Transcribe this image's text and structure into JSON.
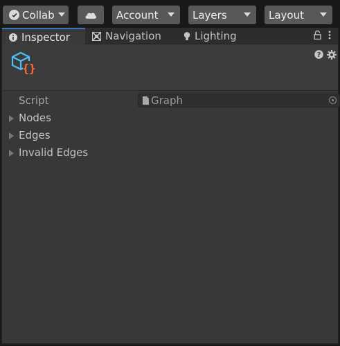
{
  "toolbar": {
    "collab_label": "Collab",
    "account_label": "Account",
    "layers_label": "Layers",
    "layout_label": "Layout",
    "icons": {
      "collab": "check-circle-icon",
      "cloud": "cloud-icon",
      "dropdown": "caret-down-icon"
    }
  },
  "tabs": [
    {
      "label": "Inspector",
      "icon": "info-icon",
      "active": true
    },
    {
      "label": "Navigation",
      "icon": "navigation-icon",
      "active": false
    },
    {
      "label": "Lighting",
      "icon": "bulb-icon",
      "active": false
    }
  ],
  "tab_actions": {
    "lock": "lock-icon",
    "menu": "kebab-menu-icon"
  },
  "header": {
    "asset_icon": "script-asset-icon",
    "help_icon": "help-icon",
    "settings_icon": "gear-icon"
  },
  "fields": {
    "script_label": "Script",
    "script_value": "Graph",
    "script_file_icon": "file-icon",
    "script_picker_icon": "object-picker-icon"
  },
  "foldouts": [
    {
      "label": "Nodes",
      "expanded": false
    },
    {
      "label": "Edges",
      "expanded": false
    },
    {
      "label": "Invalid Edges",
      "expanded": false
    }
  ],
  "colors": {
    "background": "#383838",
    "toolbar": "#191919",
    "button": "#585858",
    "active_tab_accent": "#3a79bb",
    "asset_icon_blue": "#4fc3f7",
    "asset_icon_orange": "#ff6d3a"
  }
}
